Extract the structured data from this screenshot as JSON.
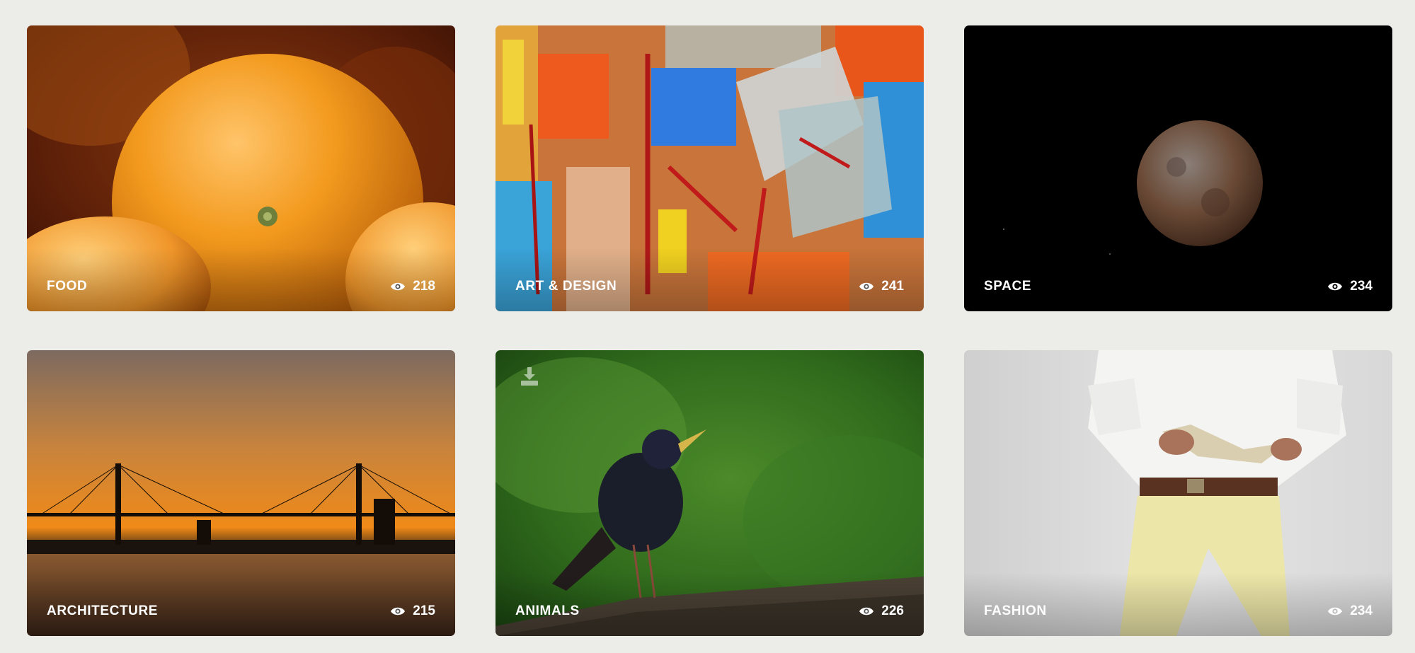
{
  "cards": [
    {
      "label": "FOOD",
      "views": "218",
      "icon": "eye-icon",
      "photo": "orange-fruit"
    },
    {
      "label": "ART & DESIGN",
      "views": "241",
      "icon": "eye-icon",
      "photo": "abstract-painting"
    },
    {
      "label": "SPACE",
      "views": "234",
      "icon": "eye-icon",
      "photo": "moon"
    },
    {
      "label": "ARCHITECTURE",
      "views": "215",
      "icon": "eye-icon",
      "photo": "suspension-bridge-sunset"
    },
    {
      "label": "ANIMALS",
      "views": "226",
      "icon": "eye-icon",
      "photo": "starling-bird",
      "extra_icon": "download-icon"
    },
    {
      "label": "FASHION",
      "views": "234",
      "icon": "eye-icon",
      "photo": "man-reading-book"
    }
  ],
  "colors": {
    "page_background": "#ecece8",
    "label_text": "#ffffff"
  }
}
